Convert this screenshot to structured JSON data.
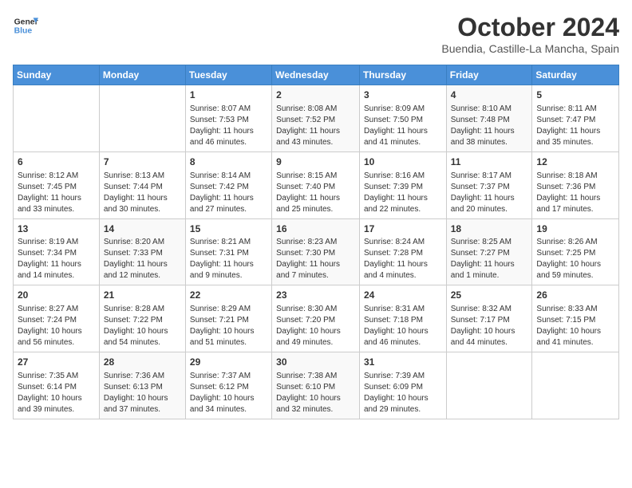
{
  "header": {
    "logo_line1": "General",
    "logo_line2": "Blue",
    "title": "October 2024",
    "subtitle": "Buendia, Castille-La Mancha, Spain"
  },
  "days_of_week": [
    "Sunday",
    "Monday",
    "Tuesday",
    "Wednesday",
    "Thursday",
    "Friday",
    "Saturday"
  ],
  "weeks": [
    [
      {
        "day": "",
        "info": ""
      },
      {
        "day": "",
        "info": ""
      },
      {
        "day": "1",
        "info": "Sunrise: 8:07 AM\nSunset: 7:53 PM\nDaylight: 11 hours and 46 minutes."
      },
      {
        "day": "2",
        "info": "Sunrise: 8:08 AM\nSunset: 7:52 PM\nDaylight: 11 hours and 43 minutes."
      },
      {
        "day": "3",
        "info": "Sunrise: 8:09 AM\nSunset: 7:50 PM\nDaylight: 11 hours and 41 minutes."
      },
      {
        "day": "4",
        "info": "Sunrise: 8:10 AM\nSunset: 7:48 PM\nDaylight: 11 hours and 38 minutes."
      },
      {
        "day": "5",
        "info": "Sunrise: 8:11 AM\nSunset: 7:47 PM\nDaylight: 11 hours and 35 minutes."
      }
    ],
    [
      {
        "day": "6",
        "info": "Sunrise: 8:12 AM\nSunset: 7:45 PM\nDaylight: 11 hours and 33 minutes."
      },
      {
        "day": "7",
        "info": "Sunrise: 8:13 AM\nSunset: 7:44 PM\nDaylight: 11 hours and 30 minutes."
      },
      {
        "day": "8",
        "info": "Sunrise: 8:14 AM\nSunset: 7:42 PM\nDaylight: 11 hours and 27 minutes."
      },
      {
        "day": "9",
        "info": "Sunrise: 8:15 AM\nSunset: 7:40 PM\nDaylight: 11 hours and 25 minutes."
      },
      {
        "day": "10",
        "info": "Sunrise: 8:16 AM\nSunset: 7:39 PM\nDaylight: 11 hours and 22 minutes."
      },
      {
        "day": "11",
        "info": "Sunrise: 8:17 AM\nSunset: 7:37 PM\nDaylight: 11 hours and 20 minutes."
      },
      {
        "day": "12",
        "info": "Sunrise: 8:18 AM\nSunset: 7:36 PM\nDaylight: 11 hours and 17 minutes."
      }
    ],
    [
      {
        "day": "13",
        "info": "Sunrise: 8:19 AM\nSunset: 7:34 PM\nDaylight: 11 hours and 14 minutes."
      },
      {
        "day": "14",
        "info": "Sunrise: 8:20 AM\nSunset: 7:33 PM\nDaylight: 11 hours and 12 minutes."
      },
      {
        "day": "15",
        "info": "Sunrise: 8:21 AM\nSunset: 7:31 PM\nDaylight: 11 hours and 9 minutes."
      },
      {
        "day": "16",
        "info": "Sunrise: 8:23 AM\nSunset: 7:30 PM\nDaylight: 11 hours and 7 minutes."
      },
      {
        "day": "17",
        "info": "Sunrise: 8:24 AM\nSunset: 7:28 PM\nDaylight: 11 hours and 4 minutes."
      },
      {
        "day": "18",
        "info": "Sunrise: 8:25 AM\nSunset: 7:27 PM\nDaylight: 11 hours and 1 minute."
      },
      {
        "day": "19",
        "info": "Sunrise: 8:26 AM\nSunset: 7:25 PM\nDaylight: 10 hours and 59 minutes."
      }
    ],
    [
      {
        "day": "20",
        "info": "Sunrise: 8:27 AM\nSunset: 7:24 PM\nDaylight: 10 hours and 56 minutes."
      },
      {
        "day": "21",
        "info": "Sunrise: 8:28 AM\nSunset: 7:22 PM\nDaylight: 10 hours and 54 minutes."
      },
      {
        "day": "22",
        "info": "Sunrise: 8:29 AM\nSunset: 7:21 PM\nDaylight: 10 hours and 51 minutes."
      },
      {
        "day": "23",
        "info": "Sunrise: 8:30 AM\nSunset: 7:20 PM\nDaylight: 10 hours and 49 minutes."
      },
      {
        "day": "24",
        "info": "Sunrise: 8:31 AM\nSunset: 7:18 PM\nDaylight: 10 hours and 46 minutes."
      },
      {
        "day": "25",
        "info": "Sunrise: 8:32 AM\nSunset: 7:17 PM\nDaylight: 10 hours and 44 minutes."
      },
      {
        "day": "26",
        "info": "Sunrise: 8:33 AM\nSunset: 7:15 PM\nDaylight: 10 hours and 41 minutes."
      }
    ],
    [
      {
        "day": "27",
        "info": "Sunrise: 7:35 AM\nSunset: 6:14 PM\nDaylight: 10 hours and 39 minutes."
      },
      {
        "day": "28",
        "info": "Sunrise: 7:36 AM\nSunset: 6:13 PM\nDaylight: 10 hours and 37 minutes."
      },
      {
        "day": "29",
        "info": "Sunrise: 7:37 AM\nSunset: 6:12 PM\nDaylight: 10 hours and 34 minutes."
      },
      {
        "day": "30",
        "info": "Sunrise: 7:38 AM\nSunset: 6:10 PM\nDaylight: 10 hours and 32 minutes."
      },
      {
        "day": "31",
        "info": "Sunrise: 7:39 AM\nSunset: 6:09 PM\nDaylight: 10 hours and 29 minutes."
      },
      {
        "day": "",
        "info": ""
      },
      {
        "day": "",
        "info": ""
      }
    ]
  ]
}
